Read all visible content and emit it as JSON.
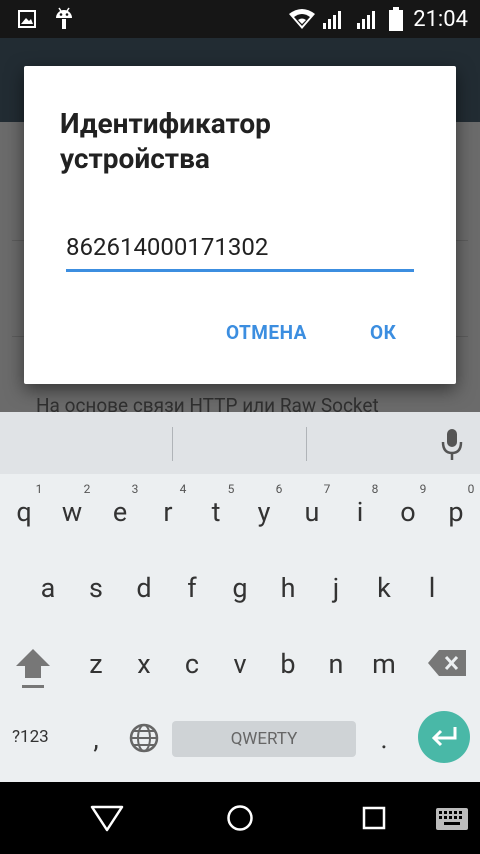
{
  "status_bar": {
    "time": "21:04",
    "icons": [
      "image-icon",
      "android-icon",
      "wifi-icon",
      "signal-icon",
      "signal-icon",
      "battery-icon"
    ]
  },
  "background_app": {
    "item_text": "На основе связи HTTP или Raw Socket"
  },
  "dialog": {
    "title": "Идентификатор устройства",
    "input_value": "862614000171302",
    "cancel_label": "ОТМЕНА",
    "ok_label": "ОК",
    "accent_color": "#3c8ee0"
  },
  "keyboard": {
    "row1": [
      "q",
      "w",
      "e",
      "r",
      "t",
      "y",
      "u",
      "i",
      "o",
      "p"
    ],
    "row1_hints": [
      "1",
      "2",
      "3",
      "4",
      "5",
      "6",
      "7",
      "8",
      "9",
      "0"
    ],
    "row2": [
      "a",
      "s",
      "d",
      "f",
      "g",
      "h",
      "j",
      "k",
      "l"
    ],
    "row3": [
      "z",
      "x",
      "c",
      "v",
      "b",
      "n",
      "m"
    ],
    "symbols_label": "?123",
    "comma": ",",
    "period": ".",
    "space_label": "QWERTY",
    "enter_color": "#49b8a7"
  },
  "nav_bar": {
    "icons": [
      "back-icon",
      "home-icon",
      "recents-icon",
      "keyboard-switch-icon"
    ]
  }
}
